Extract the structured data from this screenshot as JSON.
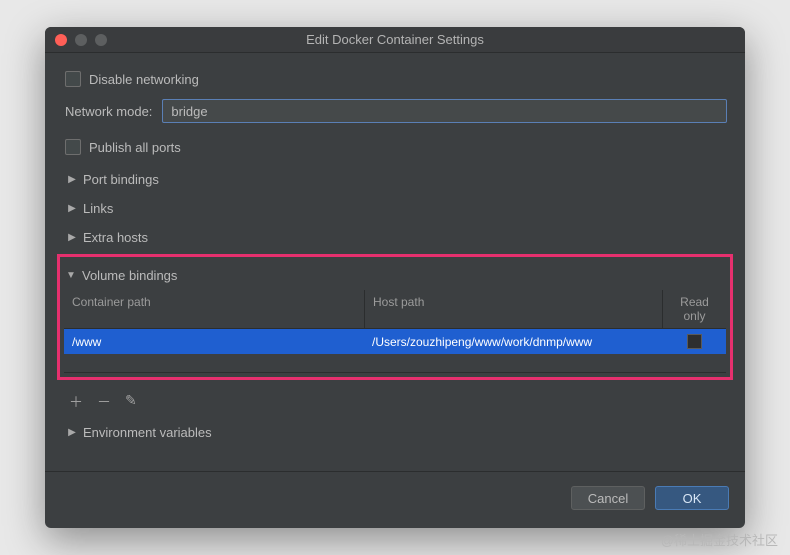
{
  "window": {
    "title": "Edit Docker Container Settings"
  },
  "options": {
    "disable_networking": "Disable networking",
    "network_mode_label": "Network mode:",
    "network_mode_value": "bridge",
    "publish_all_ports": "Publish all ports"
  },
  "sections": {
    "port_bindings": "Port bindings",
    "links": "Links",
    "extra_hosts": "Extra hosts",
    "volume_bindings": "Volume bindings",
    "environment_variables": "Environment variables"
  },
  "volume_table": {
    "headers": {
      "container": "Container path",
      "host": "Host path",
      "readonly": "Read only"
    },
    "rows": [
      {
        "container": "/www",
        "host": "/Users/zouzhipeng/www/work/dnmp/www",
        "readonly": false
      }
    ]
  },
  "buttons": {
    "cancel": "Cancel",
    "ok": "OK"
  },
  "watermark": "@稀土掘金技术社区"
}
